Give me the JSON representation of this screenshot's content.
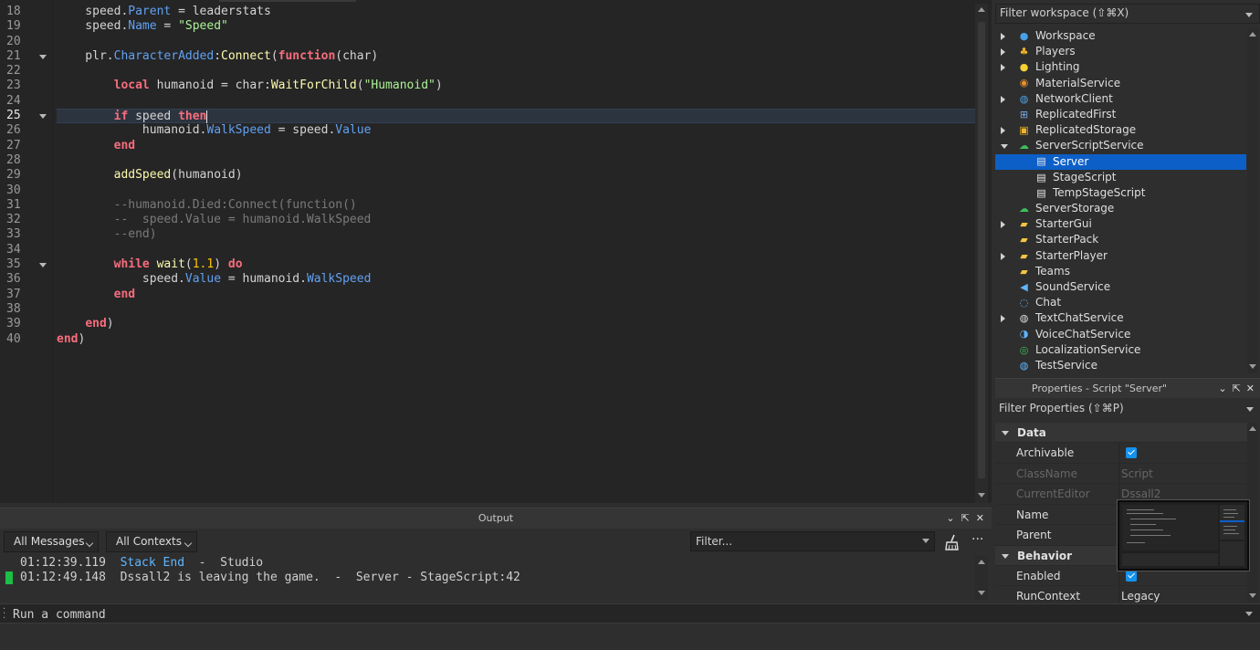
{
  "editor": {
    "lines": [
      {
        "num": "18",
        "fold": false,
        "active": false,
        "tokens": [
          [
            "plain",
            "    speed."
          ],
          [
            "prop",
            "Parent"
          ],
          [
            "plain",
            " = leaderstats"
          ]
        ]
      },
      {
        "num": "19",
        "fold": false,
        "active": false,
        "tokens": [
          [
            "plain",
            "    speed."
          ],
          [
            "prop",
            "Name"
          ],
          [
            "plain",
            " = "
          ],
          [
            "str",
            "\"Speed\""
          ]
        ]
      },
      {
        "num": "20",
        "fold": false,
        "active": false,
        "tokens": []
      },
      {
        "num": "21",
        "fold": true,
        "active": false,
        "tokens": [
          [
            "plain",
            "    plr."
          ],
          [
            "prop",
            "CharacterAdded"
          ],
          [
            "plain",
            ":"
          ],
          [
            "fn",
            "Connect"
          ],
          [
            "plain",
            "("
          ],
          [
            "kw",
            "function"
          ],
          [
            "plain",
            "(char)"
          ]
        ]
      },
      {
        "num": "22",
        "fold": false,
        "active": false,
        "tokens": []
      },
      {
        "num": "23",
        "fold": false,
        "active": false,
        "tokens": [
          [
            "plain",
            "        "
          ],
          [
            "kw",
            "local"
          ],
          [
            "plain",
            " humanoid = char:"
          ],
          [
            "fn",
            "WaitForChild"
          ],
          [
            "plain",
            "("
          ],
          [
            "str",
            "\"Humanoid\""
          ],
          [
            "plain",
            ")"
          ]
        ]
      },
      {
        "num": "24",
        "fold": false,
        "active": false,
        "tokens": []
      },
      {
        "num": "25",
        "fold": true,
        "active": true,
        "tokens": [
          [
            "plain",
            "        "
          ],
          [
            "kw",
            "if"
          ],
          [
            "plain",
            " speed "
          ],
          [
            "kw",
            "then"
          ]
        ]
      },
      {
        "num": "26",
        "fold": false,
        "active": false,
        "tokens": [
          [
            "plain",
            "            humanoid."
          ],
          [
            "prop",
            "WalkSpeed"
          ],
          [
            "plain",
            " = speed."
          ],
          [
            "prop",
            "Value"
          ]
        ]
      },
      {
        "num": "27",
        "fold": false,
        "active": false,
        "tokens": [
          [
            "plain",
            "        "
          ],
          [
            "kw",
            "end"
          ]
        ]
      },
      {
        "num": "28",
        "fold": false,
        "active": false,
        "tokens": []
      },
      {
        "num": "29",
        "fold": false,
        "active": false,
        "tokens": [
          [
            "plain",
            "        "
          ],
          [
            "fn",
            "addSpeed"
          ],
          [
            "plain",
            "(humanoid)"
          ]
        ]
      },
      {
        "num": "30",
        "fold": false,
        "active": false,
        "tokens": []
      },
      {
        "num": "31",
        "fold": false,
        "active": false,
        "tokens": [
          [
            "cmt",
            "        --humanoid.Died:Connect(function()"
          ]
        ]
      },
      {
        "num": "32",
        "fold": false,
        "active": false,
        "tokens": [
          [
            "cmt",
            "        --  speed.Value = humanoid.WalkSpeed"
          ]
        ]
      },
      {
        "num": "33",
        "fold": false,
        "active": false,
        "tokens": [
          [
            "cmt",
            "        --end)"
          ]
        ]
      },
      {
        "num": "34",
        "fold": false,
        "active": false,
        "tokens": []
      },
      {
        "num": "35",
        "fold": true,
        "active": false,
        "tokens": [
          [
            "plain",
            "        "
          ],
          [
            "kw",
            "while"
          ],
          [
            "plain",
            " "
          ],
          [
            "fn",
            "wait"
          ],
          [
            "plain",
            "("
          ],
          [
            "num",
            "1.1"
          ],
          [
            "plain",
            ") "
          ],
          [
            "kw",
            "do"
          ]
        ]
      },
      {
        "num": "36",
        "fold": false,
        "active": false,
        "tokens": [
          [
            "plain",
            "            speed."
          ],
          [
            "prop",
            "Value"
          ],
          [
            "plain",
            " = humanoid."
          ],
          [
            "prop",
            "WalkSpeed"
          ]
        ]
      },
      {
        "num": "37",
        "fold": false,
        "active": false,
        "tokens": [
          [
            "plain",
            "        "
          ],
          [
            "kw",
            "end"
          ]
        ]
      },
      {
        "num": "38",
        "fold": false,
        "active": false,
        "tokens": []
      },
      {
        "num": "39",
        "fold": false,
        "active": false,
        "tokens": [
          [
            "plain",
            "    "
          ],
          [
            "kw",
            "end"
          ],
          [
            "plain",
            ")"
          ]
        ]
      },
      {
        "num": "40",
        "fold": false,
        "active": false,
        "tokens": [
          [
            "kw",
            "end"
          ],
          [
            "plain",
            ")"
          ]
        ]
      }
    ]
  },
  "output": {
    "title": "Output",
    "messages_filter": "All Messages",
    "contexts_filter": "All Contexts",
    "filter_placeholder": "Filter...",
    "more_label": "···",
    "log": [
      {
        "time": "01:12:39.119",
        "highlight": "Stack End",
        "rest": "  -  Studio",
        "marker": false
      },
      {
        "time": "01:12:49.148",
        "highlight": "",
        "rest": "Dssall2 is leaving the game.  -  Server - StageScript:42",
        "marker": true
      }
    ]
  },
  "command_bar": {
    "placeholder": "Run a command"
  },
  "explorer": {
    "filter_placeholder": "Filter workspace (⇧⌘X)",
    "items": [
      {
        "label": "Workspace",
        "depth": 0,
        "expander": "closed",
        "icon": "workspace-icon",
        "selected": false
      },
      {
        "label": "Players",
        "depth": 0,
        "expander": "closed",
        "icon": "players-icon",
        "selected": false
      },
      {
        "label": "Lighting",
        "depth": 0,
        "expander": "closed",
        "icon": "lighting-icon",
        "selected": false
      },
      {
        "label": "MaterialService",
        "depth": 0,
        "expander": "none",
        "icon": "material-service-icon",
        "selected": false
      },
      {
        "label": "NetworkClient",
        "depth": 0,
        "expander": "closed",
        "icon": "network-client-icon",
        "selected": false
      },
      {
        "label": "ReplicatedFirst",
        "depth": 0,
        "expander": "none",
        "icon": "replicated-first-icon",
        "selected": false
      },
      {
        "label": "ReplicatedStorage",
        "depth": 0,
        "expander": "closed",
        "icon": "replicated-storage-icon",
        "selected": false
      },
      {
        "label": "ServerScriptService",
        "depth": 0,
        "expander": "open",
        "icon": "server-script-service-icon",
        "selected": false
      },
      {
        "label": "Server",
        "depth": 1,
        "expander": "none",
        "icon": "script-icon",
        "selected": true
      },
      {
        "label": "StageScript",
        "depth": 1,
        "expander": "none",
        "icon": "script-icon",
        "selected": false
      },
      {
        "label": "TempStageScript",
        "depth": 1,
        "expander": "none",
        "icon": "script-icon",
        "selected": false
      },
      {
        "label": "ServerStorage",
        "depth": 0,
        "expander": "none",
        "icon": "server-storage-icon",
        "selected": false
      },
      {
        "label": "StarterGui",
        "depth": 0,
        "expander": "closed",
        "icon": "starter-gui-icon",
        "selected": false
      },
      {
        "label": "StarterPack",
        "depth": 0,
        "expander": "none",
        "icon": "starter-pack-icon",
        "selected": false
      },
      {
        "label": "StarterPlayer",
        "depth": 0,
        "expander": "closed",
        "icon": "starter-player-icon",
        "selected": false
      },
      {
        "label": "Teams",
        "depth": 0,
        "expander": "none",
        "icon": "teams-icon",
        "selected": false
      },
      {
        "label": "SoundService",
        "depth": 0,
        "expander": "none",
        "icon": "sound-service-icon",
        "selected": false
      },
      {
        "label": "Chat",
        "depth": 0,
        "expander": "none",
        "icon": "chat-icon",
        "selected": false
      },
      {
        "label": "TextChatService",
        "depth": 0,
        "expander": "closed",
        "icon": "text-chat-service-icon",
        "selected": false
      },
      {
        "label": "VoiceChatService",
        "depth": 0,
        "expander": "none",
        "icon": "voice-chat-service-icon",
        "selected": false
      },
      {
        "label": "LocalizationService",
        "depth": 0,
        "expander": "none",
        "icon": "localization-service-icon",
        "selected": false
      },
      {
        "label": "TestService",
        "depth": 0,
        "expander": "none",
        "icon": "test-service-icon",
        "selected": false
      }
    ]
  },
  "properties": {
    "title": "Properties - Script \"Server\"",
    "filter_placeholder": "Filter Properties (⇧⌘P)",
    "sections": [
      {
        "name": "Data",
        "rows": [
          {
            "name": "Archivable",
            "value": "",
            "checkbox": true,
            "dim": false
          },
          {
            "name": "ClassName",
            "value": "Script",
            "checkbox": false,
            "dim": true
          },
          {
            "name": "CurrentEditor",
            "value": "Dssall2",
            "checkbox": false,
            "dim": true
          },
          {
            "name": "Name",
            "value": "",
            "checkbox": false,
            "dim": false
          },
          {
            "name": "Parent",
            "value": "",
            "checkbox": false,
            "dim": false
          }
        ]
      },
      {
        "name": "Behavior",
        "rows": [
          {
            "name": "Enabled",
            "value": "",
            "checkbox": true,
            "dim": false
          },
          {
            "name": "RunContext",
            "value": "Legacy",
            "checkbox": false,
            "dim": false
          }
        ]
      }
    ]
  },
  "colors": {
    "selection": "#0d5fc8",
    "keyword": "#f86d7c",
    "property": "#61a1f1",
    "function": "#fdfbac",
    "string": "#adf195",
    "number": "#ffc600",
    "comment": "#7a7a7a",
    "log_marker": "#1cbe49",
    "log_highlight": "#5fb6ff"
  }
}
